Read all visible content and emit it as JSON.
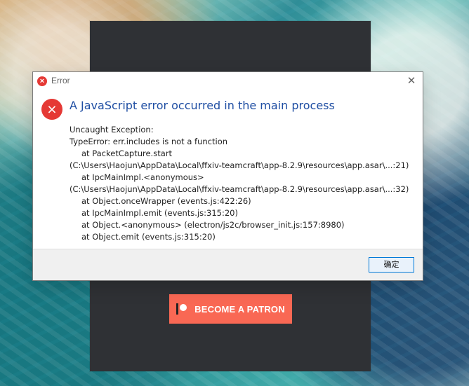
{
  "background": {
    "patreon_button_label": "BECOME A PATRON"
  },
  "dialog": {
    "window_title": "Error",
    "heading": "A JavaScript error occurred in the main process",
    "close_icon": "close-icon",
    "error_icon": "error-icon",
    "message_lines": [
      "Uncaught Exception:",
      "TypeError: err.includes is not a function",
      "at PacketCapture.start",
      "(C:\\Users\\Haojun\\AppData\\Local\\ffxiv-teamcraft\\app-8.2.9\\resources\\app.asar\\...:21)",
      "at IpcMainImpl.<anonymous>",
      "(C:\\Users\\Haojun\\AppData\\Local\\ffxiv-teamcraft\\app-8.2.9\\resources\\app.asar\\...:32)",
      "at Object.onceWrapper (events.js:422:26)",
      "at IpcMainImpl.emit (events.js:315:20)",
      "at Object.<anonymous> (electron/js2c/browser_init.js:157:8980)",
      "at Object.emit (events.js:315:20)"
    ],
    "ok_label": "确定"
  },
  "colors": {
    "error_red": "#e53935",
    "heading_blue": "#1f4ea3",
    "patreon_orange": "#f96854",
    "app_background": "#2f3135"
  }
}
